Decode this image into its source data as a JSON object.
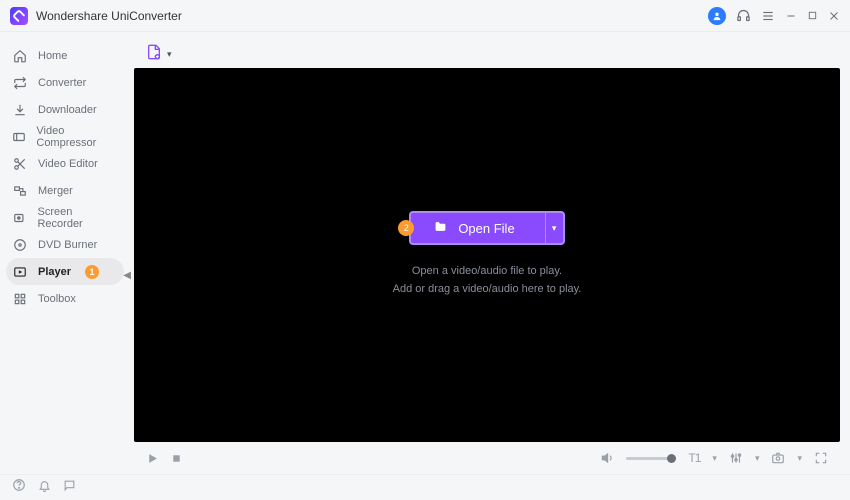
{
  "app": {
    "title": "Wondershare UniConverter"
  },
  "sidebar": {
    "items": [
      {
        "label": "Home",
        "icon": "home"
      },
      {
        "label": "Converter",
        "icon": "converter"
      },
      {
        "label": "Downloader",
        "icon": "downloader"
      },
      {
        "label": "Video Compressor",
        "icon": "compressor"
      },
      {
        "label": "Video Editor",
        "icon": "editor"
      },
      {
        "label": "Merger",
        "icon": "merger"
      },
      {
        "label": "Screen Recorder",
        "icon": "recorder"
      },
      {
        "label": "DVD Burner",
        "icon": "dvd"
      },
      {
        "label": "Player",
        "icon": "player",
        "active": true,
        "badge": "1"
      },
      {
        "label": "Toolbox",
        "icon": "toolbox"
      }
    ]
  },
  "toolbar": {
    "add_file_icon": "add-document"
  },
  "player": {
    "open_button_label": "Open File",
    "hint_line1": "Open a video/audio file to play.",
    "hint_line2": "Add or drag a video/audio here to play.",
    "marker_number": "2"
  },
  "controls": {
    "subtitle_label": "T1"
  },
  "colors": {
    "accent": "#8a4bff",
    "badge": "#ff9a2e",
    "avatar": "#2d7cff"
  }
}
